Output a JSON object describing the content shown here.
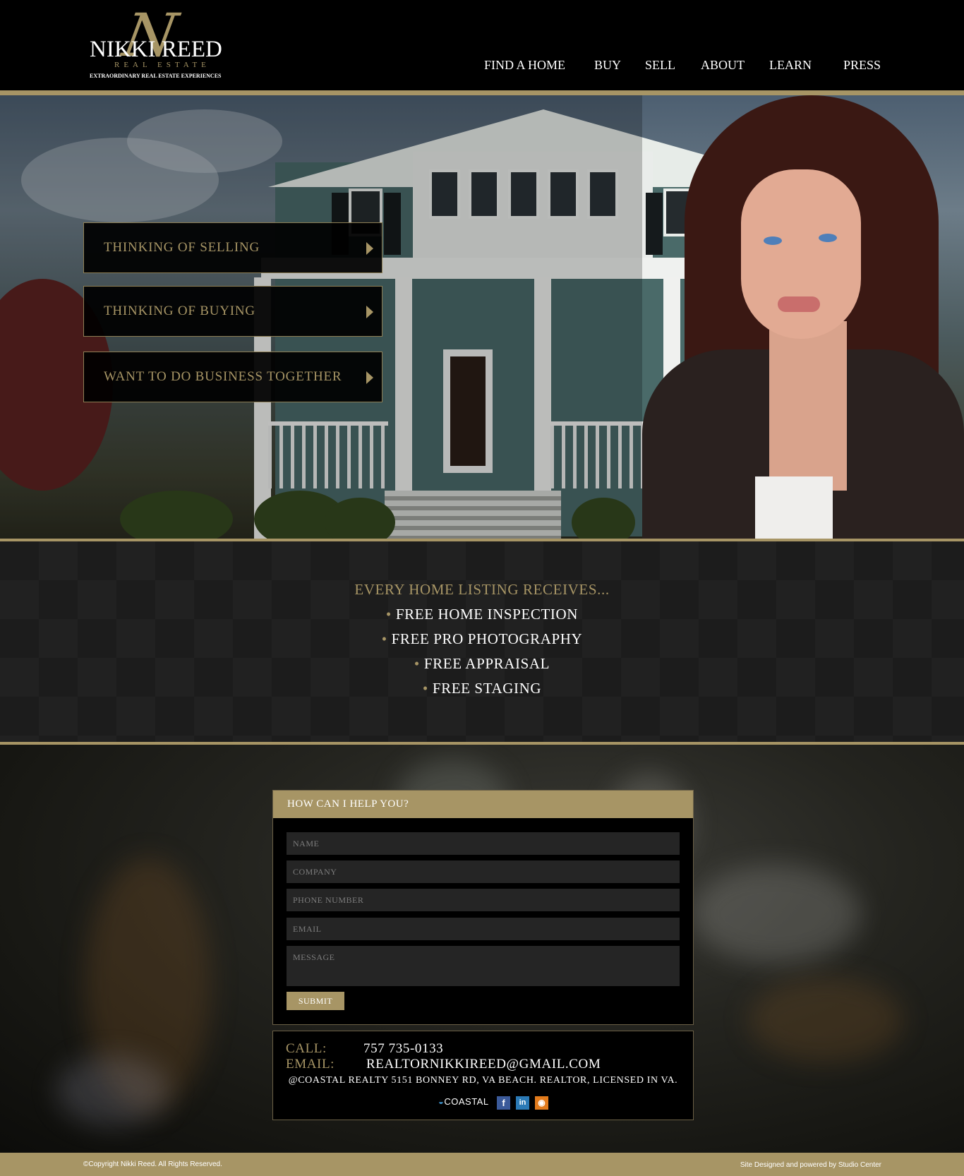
{
  "brand": {
    "monogram": "N",
    "name": "NIKKI REED",
    "subtitle": "REAL ESTATE",
    "tagline": "EXTRAORDINARY REAL ESTATE EXPERIENCES"
  },
  "nav": {
    "items": [
      "FIND A HOME",
      "BUY",
      "SELL",
      "ABOUT",
      "LEARN",
      "PRESS"
    ]
  },
  "hero": {
    "ctas": [
      "THINKING OF SELLING",
      "THINKING OF BUYING",
      "WANT TO DO BUSINESS TOGETHER"
    ]
  },
  "listing": {
    "title": "EVERY HOME LISTING RECEIVES...",
    "bullet": "•",
    "items": [
      "FREE HOME INSPECTION",
      "FREE PRO PHOTOGRAPHY",
      "FREE APPRAISAL",
      "FREE STAGING"
    ]
  },
  "contact": {
    "heading": "HOW CAN I HELP YOU?",
    "fields": {
      "name": "NAME",
      "company": "COMPANY",
      "phone": "PHONE NUMBER",
      "email": "EMAIL",
      "message": "MESSAGE"
    },
    "submit_label": "SUBMIT"
  },
  "info": {
    "call_label": "CALL:",
    "call_value": "757 735-0133",
    "email_label": "EMAIL:",
    "email_value": "REALTORNIKKIREED@GMAIL.COM",
    "address": "@COASTAL REALTY 5151 BONNEY RD, VA BEACH. REALTOR, LICENSED IN VA.",
    "coastal_logo": "COASTAL",
    "social_icons": [
      "facebook-icon",
      "linkedin-icon",
      "rss-icon"
    ],
    "facebook_glyph": "f",
    "linkedin_glyph": "in",
    "rss_glyph": "◉"
  },
  "footer": {
    "copyright": "©Copyright Nikki Reed. All Rights Reserved.",
    "credit": "Site Designed and powered by Studio Center"
  },
  "colors": {
    "gold": "#a79565",
    "black": "#000000",
    "field_bg": "#252525"
  }
}
